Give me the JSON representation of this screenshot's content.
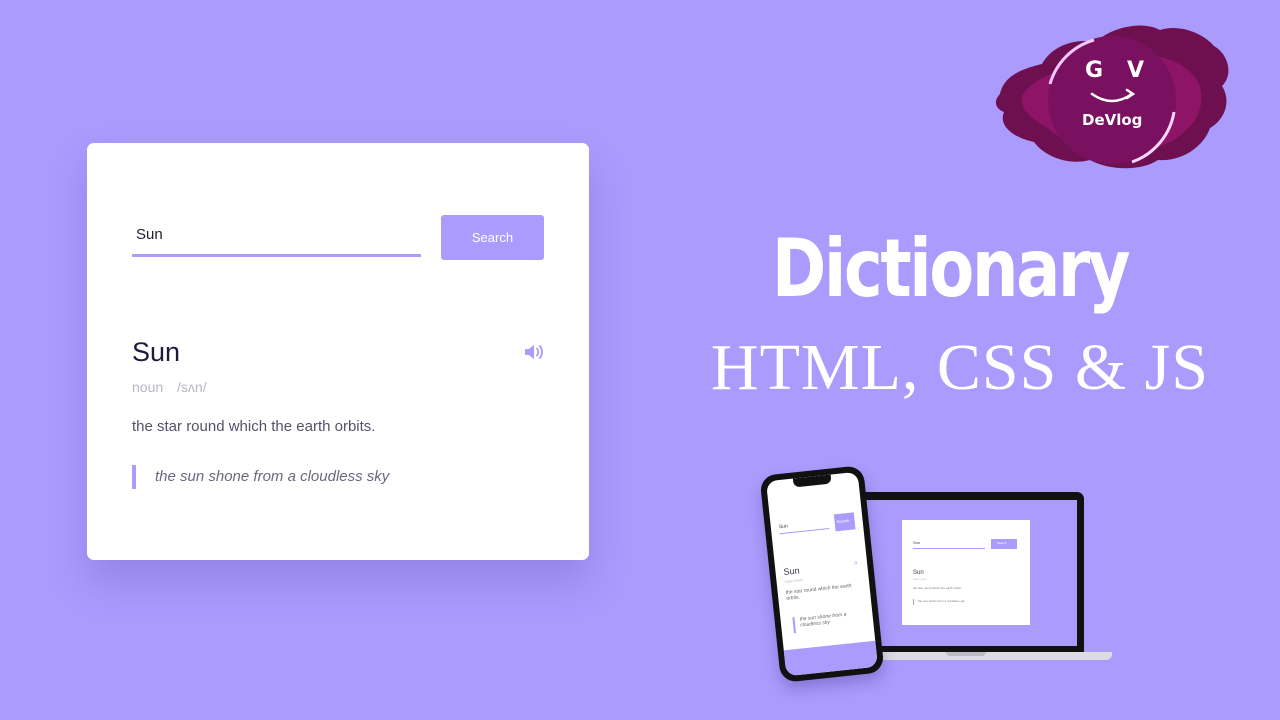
{
  "search": {
    "value": "Sun",
    "button_label": "Search"
  },
  "result": {
    "word": "Sun",
    "part_of_speech": "noun",
    "phonetic": "/sʌn/",
    "meaning": "the star round which the earth orbits.",
    "example": "the sun shone from a cloudless sky"
  },
  "logo": {
    "letter_g": "G",
    "letter_v": "V",
    "name": "DeVlog"
  },
  "headline": {
    "title": "Dictionary",
    "subtitle": "HTML, CSS & JS"
  },
  "mockup": {
    "search_value": "Sun",
    "button_label": "Search",
    "word": "Sun",
    "details": "noun /sʌn/",
    "meaning": "the star round which the earth orbits.",
    "example": "the sun shone from a cloudless sky"
  },
  "colors": {
    "background": "#ab9bfd",
    "accent": "#ab9bfd",
    "card": "#ffffff",
    "word_text": "#1e1b3a"
  },
  "icons": {
    "sound": "volume-icon",
    "logo_arrow": "smile-arrow-icon"
  }
}
